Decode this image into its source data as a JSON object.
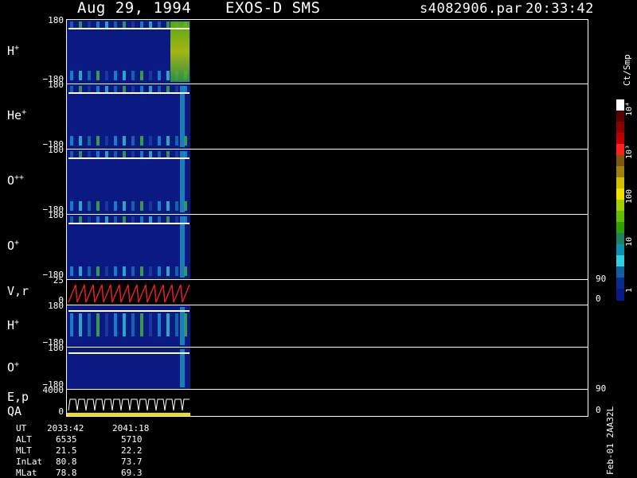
{
  "header": {
    "date": "Aug 29, 1994",
    "instrument": "EXOS-D SMS",
    "file": "s4082906.par",
    "time": "20:33:42"
  },
  "panels": [
    {
      "label": "H",
      "sup": "+",
      "top": "180",
      "bottom": "−180"
    },
    {
      "label": "He",
      "sup": "+",
      "top": "180",
      "bottom": "−180"
    },
    {
      "label": "O",
      "sup": "++",
      "top": "180",
      "bottom": "−180"
    },
    {
      "label": "O",
      "sup": "+",
      "top": "180",
      "bottom": "−180"
    },
    {
      "label": "V,r",
      "sup": "",
      "top": "25",
      "bottom": "0",
      "right_top": "90",
      "right_bottom": "0"
    },
    {
      "label": "H",
      "sup": "+",
      "top": "180",
      "bottom": "−180"
    },
    {
      "label": "O",
      "sup": "+",
      "top": "180",
      "bottom": "−180"
    },
    {
      "label": "E,p",
      "label2": "QA",
      "sup": "",
      "top": "4000",
      "bottom": "0",
      "right_top": "90",
      "right_bottom": "0"
    }
  ],
  "colorbar": {
    "unit": "Ct/Smp",
    "ticks": [
      "10⁴",
      "10³",
      "100",
      "10",
      "1"
    ],
    "colors": [
      "#ffffff",
      "#5a0000",
      "#8b0000",
      "#c00000",
      "#ff2020",
      "#7a5a10",
      "#a08010",
      "#d0c000",
      "#f0e000",
      "#a0d000",
      "#60c000",
      "#30a000",
      "#208060",
      "#1090b0",
      "#30d0e0",
      "#1060a0",
      "#0a2a90",
      "#0a1a82"
    ]
  },
  "info": {
    "rows": [
      {
        "key": "UT",
        "v1": "2033:42",
        "v2": "2041:18"
      },
      {
        "key": "ALT",
        "v1": "6535",
        "v2": "5710"
      },
      {
        "key": "MLT",
        "v1": "21.5",
        "v2": "22.2"
      },
      {
        "key": "InLat",
        "v1": "80.8",
        "v2": "73.7"
      },
      {
        "key": "MLat",
        "v1": "78.8",
        "v2": "69.3"
      }
    ]
  },
  "footer": {
    "stamp": "Feb-01 2AA32L"
  }
}
